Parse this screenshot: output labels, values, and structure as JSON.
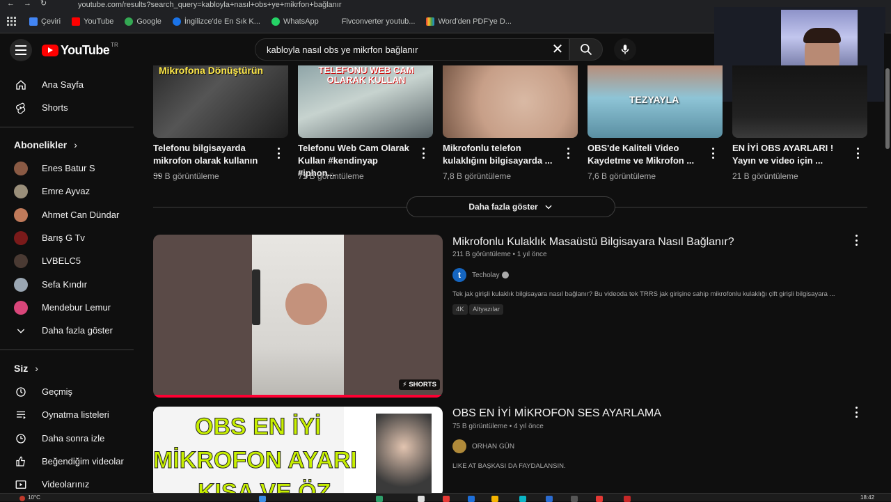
{
  "browser": {
    "url": "youtube.com/results?search_query=kabloyla+nasıl+obs+ye+mikrfon+bağlanır",
    "bookmarks": [
      {
        "label": "Çeviri",
        "color": "#4285f4"
      },
      {
        "label": "YouTube",
        "color": "#ff0000"
      },
      {
        "label": "Google",
        "color": "#34a853"
      },
      {
        "label": "İngilizce'de En Sık K...",
        "color": "#1a73e8"
      },
      {
        "label": "WhatsApp",
        "color": "#25d366"
      },
      {
        "label": "Flvconverter youtub...",
        "color": "#202124"
      },
      {
        "label": "Word'den PDF'ye D...",
        "color": "#f4b400"
      }
    ]
  },
  "header": {
    "logo_text": "YouTube",
    "country": "TR",
    "search_value": "kabloyla nasıl obs ye mikrfon bağlanır"
  },
  "sidebar": {
    "main": [
      {
        "label": "Ana Sayfa",
        "icon": "home-icon"
      },
      {
        "label": "Shorts",
        "icon": "shorts-icon"
      }
    ],
    "subscriptions_title": "Abonelikler",
    "subscriptions": [
      {
        "label": "Enes Batur S",
        "color": "#8a5a44"
      },
      {
        "label": "Emre Ayvaz",
        "color": "#9a8f7a"
      },
      {
        "label": "Ahmet Can Dündar",
        "color": "#c07a5a"
      },
      {
        "label": "Barış G Tv",
        "color": "#7a1a1a"
      },
      {
        "label": "LVBELC5",
        "color": "#4a3a33"
      },
      {
        "label": "Sefa Kındır",
        "color": "#9aa6b2"
      },
      {
        "label": "Mendebur Lemur",
        "color": "#d9467a"
      }
    ],
    "show_more": "Daha fazla göster",
    "you_title": "Siz",
    "you_items": [
      {
        "label": "Geçmiş",
        "icon": "history-icon"
      },
      {
        "label": "Oynatma listeleri",
        "icon": "playlists-icon"
      },
      {
        "label": "Daha sonra izle",
        "icon": "watch-later-icon"
      },
      {
        "label": "Beğendiğim videolar",
        "icon": "liked-icon"
      },
      {
        "label": "Videolarınız",
        "icon": "your-videos-icon"
      }
    ]
  },
  "shelf": {
    "items": [
      {
        "caption": "Mikrofona Dönüştürün",
        "title1": "Telefonu bilgisayarda",
        "title2": "mikrofon olarak kullanın ...",
        "views": "39 B görüntüleme"
      },
      {
        "caption": "TELEFONU WEB CAM OLARAK KULLAN",
        "title1": "Telefonu Web Cam Olarak",
        "title2": "Kullan #kendinyap #iphon...",
        "views": "71 B görüntüleme"
      },
      {
        "caption": "",
        "title1": "Mikrofonlu telefon",
        "title2": "kulaklığını bilgisayarda ...",
        "views": "7,8 B görüntüleme"
      },
      {
        "caption": "TEZYAYLA",
        "title1": "OBS'de Kaliteli Video",
        "title2": "Kaydetme ve Mikrofon ...",
        "views": "7,6 B görüntüleme"
      },
      {
        "caption": "",
        "title1": "EN İYİ OBS AYARLARI !",
        "title2": "Yayın ve video için ...",
        "views": "21 B görüntüleme"
      }
    ],
    "show_more": "Daha fazla göster"
  },
  "results": [
    {
      "title": "Mikrofonlu Kulaklık Masaüstü Bilgisayara Nasıl Bağlanır?",
      "meta": "211 B görüntüleme • 1 yıl önce",
      "channel": "Techolay",
      "description": "Tek jak girişli kulaklık bilgisayara nasıl bağlanır? Bu videoda tek TRRS jak girişine sahip mikrofonlu kulaklığı çift girişli bilgisayara ...",
      "badges": [
        "4K",
        "Altyazılar"
      ],
      "shorts_label": "SHORTS"
    },
    {
      "title": "OBS EN İYİ MİKROFON SES AYARLAMA",
      "meta": "75 B görüntüleme • 4 yıl önce",
      "channel": "ORHAN GÜN",
      "description": "LIKE AT BAŞKASI DA FAYDALANSIN.",
      "thumb_line1": "OBS EN İYİ",
      "thumb_line2": "MİKROFON AYARI",
      "thumb_line3": "KISA VE ÖZ"
    }
  ],
  "taskbar": {
    "weather": "10°C",
    "clock": "18:42"
  }
}
